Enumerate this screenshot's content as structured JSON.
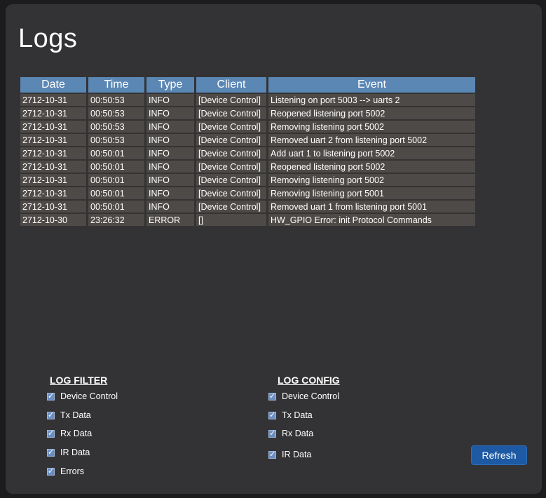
{
  "page": {
    "title": "Logs"
  },
  "table": {
    "headers": [
      "Date",
      "Time",
      "Type",
      "Client",
      "Event"
    ],
    "rows": [
      [
        "2712-10-31",
        "00:50:53",
        "INFO",
        "[Device Control]",
        "Listening on port 5003 --> uarts 2"
      ],
      [
        "2712-10-31",
        "00:50:53",
        "INFO",
        "[Device Control]",
        "Reopened listening port 5002"
      ],
      [
        "2712-10-31",
        "00:50:53",
        "INFO",
        "[Device Control]",
        "Removing listening port 5002"
      ],
      [
        "2712-10-31",
        "00:50:53",
        "INFO",
        "[Device Control]",
        "Removed uart 2 from listening port 5002"
      ],
      [
        "2712-10-31",
        "00:50:01",
        "INFO",
        "[Device Control]",
        "Add uart 1 to listening port 5002"
      ],
      [
        "2712-10-31",
        "00:50:01",
        "INFO",
        "[Device Control]",
        "Reopened listening port 5002"
      ],
      [
        "2712-10-31",
        "00:50:01",
        "INFO",
        "[Device Control]",
        "Removing listening port 5002"
      ],
      [
        "2712-10-31",
        "00:50:01",
        "INFO",
        "[Device Control]",
        "Removing listening port 5001"
      ],
      [
        "2712-10-31",
        "00:50:01",
        "INFO",
        "[Device Control]",
        "Removed uart 1 from listening port 5001"
      ],
      [
        "2712-10-30",
        "23:26:32",
        "ERROR",
        "[]",
        "HW_GPIO Error: init Protocol Commands"
      ]
    ]
  },
  "log_filter": {
    "title": "LOG FILTER",
    "items": [
      {
        "label": "Device Control",
        "checked": true
      },
      {
        "label": "Tx Data",
        "checked": true
      },
      {
        "label": "Rx Data",
        "checked": true
      },
      {
        "label": "IR Data",
        "checked": true
      },
      {
        "label": "Errors",
        "checked": true
      }
    ]
  },
  "log_config": {
    "title": "LOG CONFIG",
    "items": [
      {
        "label": "Device Control",
        "checked": true
      },
      {
        "label": "Tx Data",
        "checked": true
      },
      {
        "label": "Rx Data",
        "checked": true
      },
      {
        "label": "IR Data",
        "checked": true
      }
    ]
  },
  "refresh": {
    "label": "Refresh"
  },
  "colors": {
    "header_bg": "#5b87b4",
    "row_bg": "#4e4a47",
    "panel_bg": "#333335",
    "button_bg": "#1d5aa3"
  }
}
